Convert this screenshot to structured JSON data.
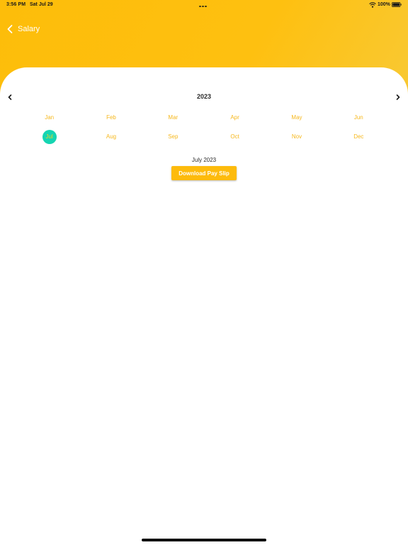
{
  "status_bar": {
    "time": "3:56 PM",
    "date": "Sat Jul 29",
    "battery": "100%",
    "icons": [
      "more-dots-icon",
      "wifi-icon",
      "battery-icon"
    ]
  },
  "header": {
    "back_icon": "chevron-left-icon",
    "title": "Salary"
  },
  "calendar": {
    "year": "2023",
    "prev_icon": "chevron-left-icon",
    "next_icon": "chevron-right-icon",
    "months": [
      "Jan",
      "Feb",
      "Mar",
      "Apr",
      "May",
      "Jun",
      "Jul",
      "Aug",
      "Sep",
      "Oct",
      "Nov",
      "Dec"
    ],
    "selected_month": "Jul"
  },
  "selection": {
    "label": "July 2023",
    "button_label": "Download Pay Slip"
  },
  "colors": {
    "brand": "#fdbb0c",
    "month_text": "#f6b81e",
    "selected_bg": "#15d5b2"
  }
}
